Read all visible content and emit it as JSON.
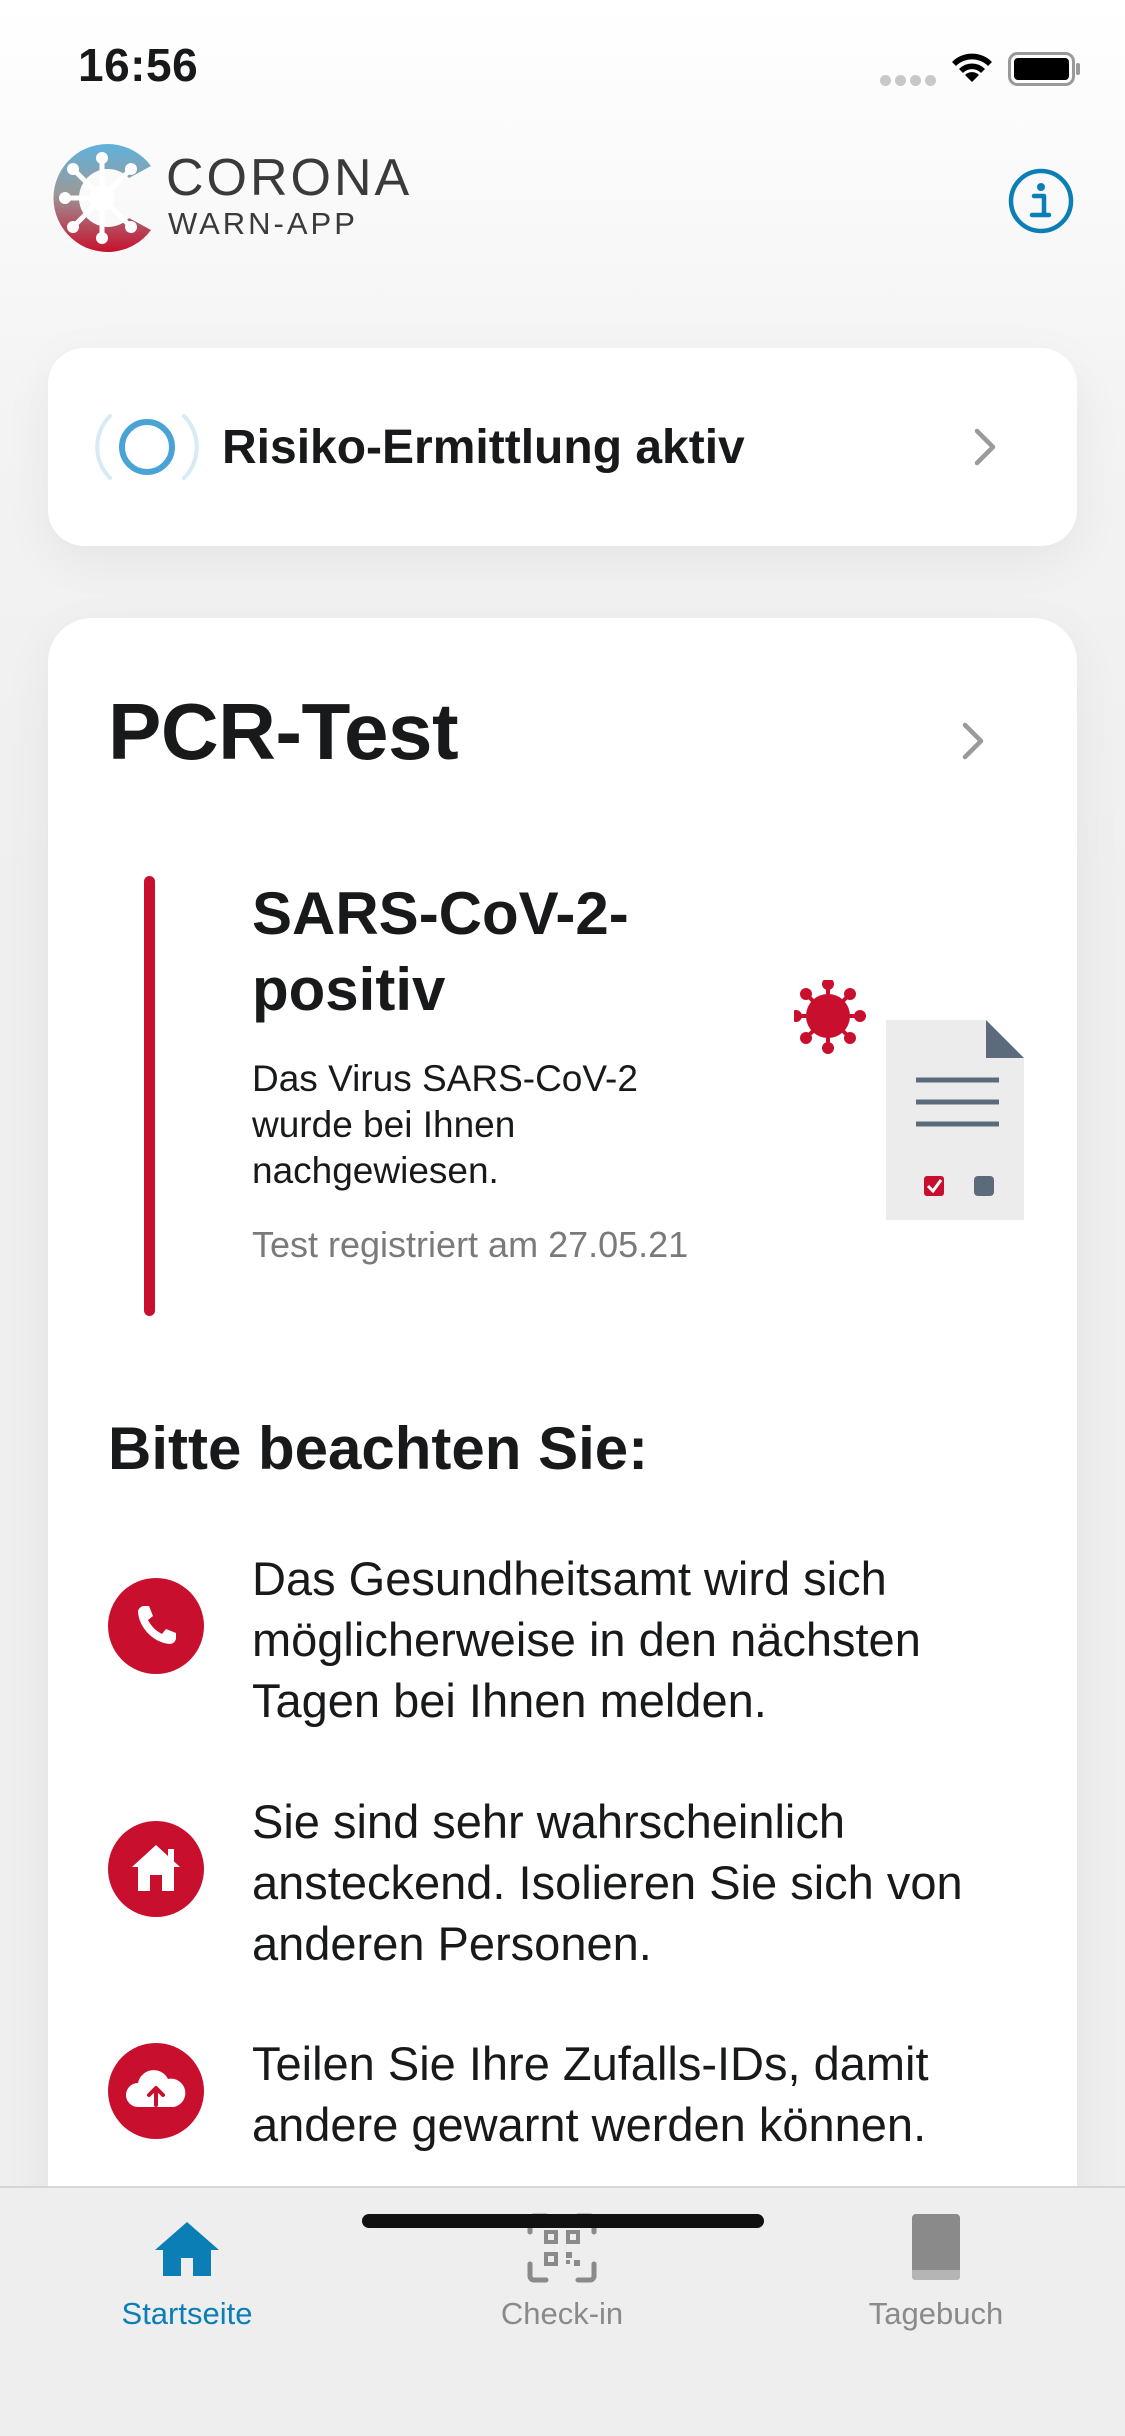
{
  "status_bar": {
    "time": "16:56"
  },
  "header": {
    "brand_title": "CORONA",
    "brand_subtitle": "WARN-APP"
  },
  "risk_card": {
    "label": "Risiko-Ermittlung aktiv"
  },
  "test_card": {
    "title": "PCR-Test",
    "result_title": "SARS-CoV-2-\npositiv",
    "result_description": "Das Virus SARS-CoV-2 wurde bei Ihnen nachgewiesen.",
    "result_date": "Test registriert am 27.05.21",
    "notice_title": "Bitte beachten Sie:",
    "notices": [
      {
        "icon": "phone-icon",
        "text": "Das Gesundheitsamt wird sich möglicherweise in den nächsten Tagen bei Ihnen melden."
      },
      {
        "icon": "home-icon",
        "text": "Sie sind sehr wahrscheinlich ansteckend. Isolieren Sie sich von anderen Personen."
      },
      {
        "icon": "cloud-upload-icon",
        "text": "Teilen Sie Ihre Zufalls-IDs, damit andere gewarnt werden können."
      }
    ]
  },
  "tab_bar": {
    "tabs": [
      {
        "label": "Startseite",
        "icon": "home-icon",
        "active": true
      },
      {
        "label": "Check-in",
        "icon": "qr-code-icon",
        "active": false
      },
      {
        "label": "Tagebuch",
        "icon": "book-icon",
        "active": false
      }
    ]
  },
  "colors": {
    "accent": "#0b7fb5",
    "alert": "#c8102e",
    "text": "#17191a",
    "muted": "#7a7a7a"
  }
}
